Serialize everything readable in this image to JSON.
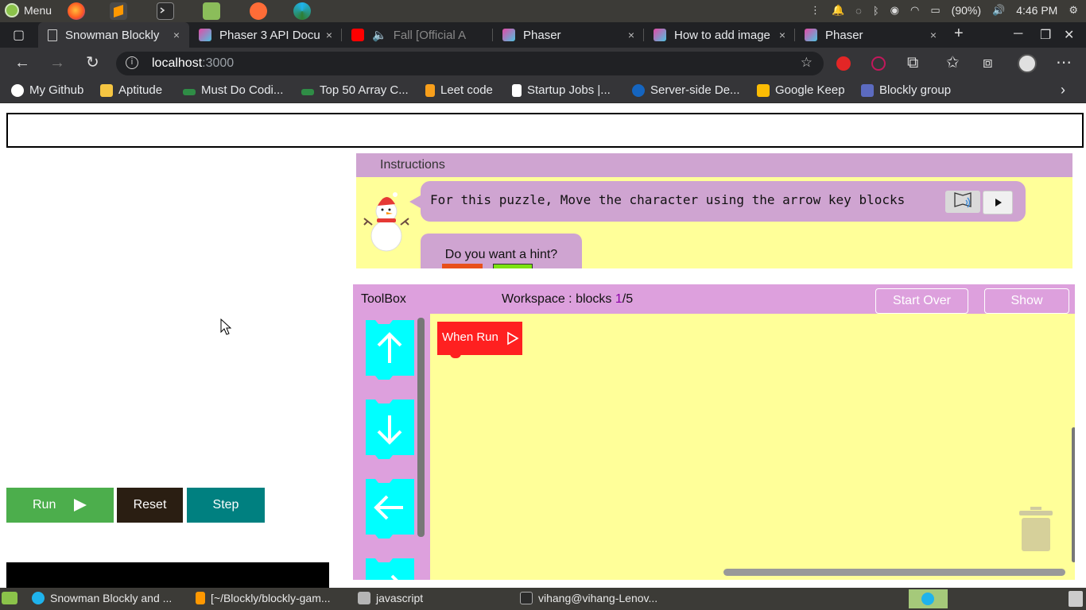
{
  "os_panel": {
    "menu_label": "Menu",
    "battery": "(90%)",
    "clock": "4:46 PM"
  },
  "tabs": [
    {
      "title": "Snowman Blockly",
      "active": true,
      "close": "×"
    },
    {
      "title": "Phaser 3 API Docu",
      "close": "×"
    },
    {
      "title": "Fall [Official A",
      "close": ""
    },
    {
      "title": "Phaser",
      "close": "×"
    },
    {
      "title": "How to add image",
      "close": "×"
    },
    {
      "title": "Phaser",
      "close": "×"
    }
  ],
  "address": {
    "host": "localhost",
    "port": ":3000"
  },
  "bookmarks": [
    {
      "label": "My Github"
    },
    {
      "label": "Aptitude"
    },
    {
      "label": "Must Do Codi..."
    },
    {
      "label": "Top 50 Array C..."
    },
    {
      "label": "Leet code"
    },
    {
      "label": "Startup Jobs |..."
    },
    {
      "label": "Server-side De..."
    },
    {
      "label": "Google Keep"
    },
    {
      "label": "Blockly group"
    }
  ],
  "instructions": {
    "header": "Instructions",
    "message": "For this puzzle, Move the character using the arrow key blocks",
    "hint_question": "Do you want a hint?"
  },
  "workspace": {
    "toolbox_label": "ToolBox",
    "ws_prefix": "Workspace : blocks ",
    "ws_count": "1",
    "ws_total": "/5",
    "start_over": "Start Over",
    "show": "Show",
    "when_run": "When Run"
  },
  "controls": {
    "run": "Run",
    "reset": "Reset",
    "step": "Step"
  },
  "taskbar": [
    {
      "label": "Snowman Blockly and ..."
    },
    {
      "label": "[~/Blockly/blockly-gam..."
    },
    {
      "label": "javascript"
    },
    {
      "label": "vihang@vihang-Lenov..."
    }
  ]
}
